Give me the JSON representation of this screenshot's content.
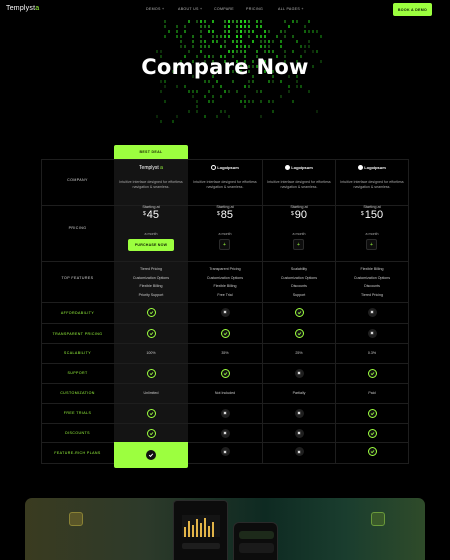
{
  "nav": {
    "logo_main": "Templyst",
    "logo_suffix": "a",
    "menu": [
      "DEMOS +",
      "ABOUT US +",
      "COMPARE",
      "PRICING",
      "ALL PAGES +"
    ],
    "cta_label": "BOOK A DEMO"
  },
  "hero": {
    "title": "Compare Now"
  },
  "table": {
    "best_badge": "BEST DEAL",
    "row_labels": {
      "company": "COMPANY",
      "pricing": "PRICING",
      "top_features": "TOP FEATURES",
      "affordability": "AFFORDABILITY",
      "transparent_pricing": "TRANSPARENT PRICING",
      "scalability": "SCALABILITY",
      "support": "SUPPORT",
      "customization": "CUSTOMIZATION",
      "free_trials": "FREE TRIALS",
      "discounts": "DISCOUNTS",
      "feature_rich_plans": "FEATURE-RICH PLANS"
    },
    "columns": [
      {
        "name": "Templyst",
        "desc": "Intuitive interface designed for effortless navigation & seamless.",
        "starting": "Starting at",
        "currency": "$",
        "price": "45",
        "per": "a month",
        "button": "PURCHASE NOW",
        "features": [
          "Tiered Pricing",
          "Customization Options",
          "Flexible Billing",
          "Priority Support"
        ],
        "scalability": "100%",
        "customization": "Unlimited"
      },
      {
        "name": "Logoipsum",
        "desc": "Intuitive interface designed for effortless navigation & seamless.",
        "starting": "Starting at",
        "currency": "$",
        "price": "85",
        "per": "a month",
        "button": "+",
        "features": [
          "Transparent Pricing",
          "Customization Options",
          "Flexible Billing",
          "Free Trial"
        ],
        "scalability": "35%",
        "customization": "Not Included"
      },
      {
        "name": "Logoipsum",
        "desc": "Intuitive interface designed for effortless navigation & seamless.",
        "starting": "Starting at",
        "currency": "$",
        "price": "90",
        "per": "a month",
        "button": "+",
        "features": [
          "Scalability",
          "Customization Options",
          "Discounts",
          "Support"
        ],
        "scalability": "25%",
        "customization": "Partially"
      },
      {
        "name": "Logoipsum",
        "desc": "Intuitive interface designed for effortless navigation & seamless.",
        "starting": "Starting at",
        "currency": "$",
        "price": "150",
        "per": "a month",
        "button": "+",
        "features": [
          "Flexible Billing",
          "Customization Options",
          "Discounts",
          "Tiered Pricing"
        ],
        "scalability": "0.3%",
        "customization": "Paid"
      }
    ],
    "checks": {
      "affordability": [
        true,
        false,
        true,
        false
      ],
      "transparent_pricing": [
        true,
        true,
        true,
        false
      ],
      "support": [
        true,
        true,
        false,
        true
      ],
      "free_trials": [
        true,
        false,
        false,
        true
      ],
      "discounts": [
        true,
        false,
        false,
        true
      ]
    },
    "colors": {
      "accent": "#9cff3f",
      "row_label": "#9cff3f",
      "bg": "#000000"
    }
  }
}
